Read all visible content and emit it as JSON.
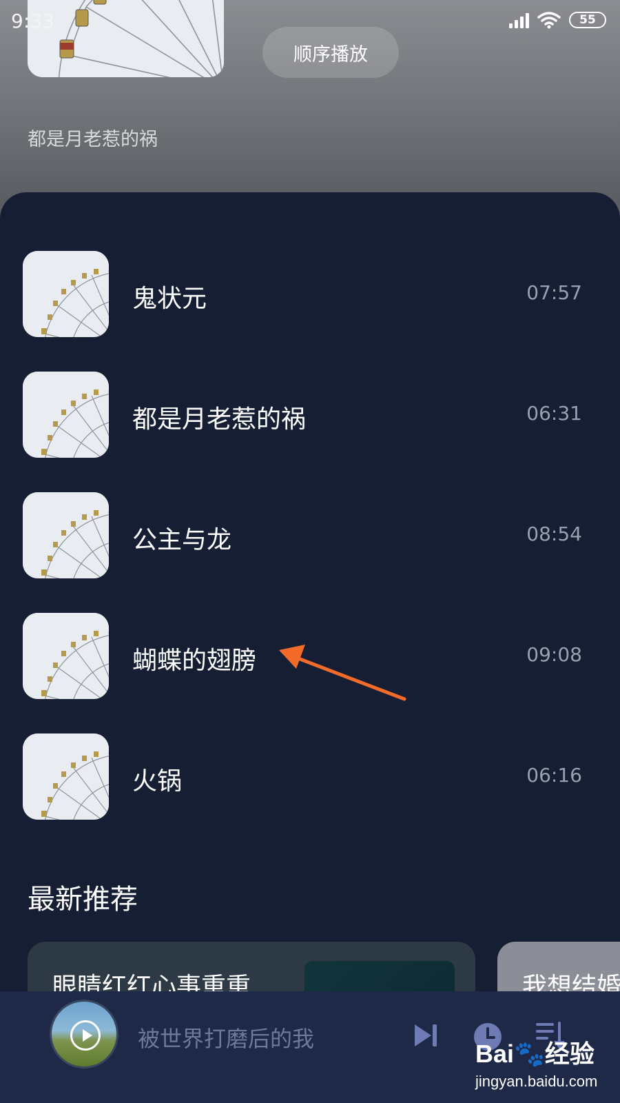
{
  "status_bar": {
    "time": "9:33",
    "battery": "55"
  },
  "header": {
    "play_mode_label": "顺序播放",
    "current_album": "都是月老惹的祸"
  },
  "playlist": [
    {
      "title": "鬼状元",
      "duration": "07:57"
    },
    {
      "title": "都是月老惹的祸",
      "duration": "06:31"
    },
    {
      "title": "公主与龙",
      "duration": "08:54"
    },
    {
      "title": "蝴蝶的翅膀",
      "duration": "09:08"
    },
    {
      "title": "火锅",
      "duration": "06:16"
    }
  ],
  "recommend": {
    "section_title": "最新推荐",
    "cards": [
      {
        "title": "眼睛红红心事重重"
      },
      {
        "title": "我想结婚"
      }
    ]
  },
  "mini_player": {
    "now_playing": "被世界打磨后的我"
  },
  "watermark": {
    "brand": "Bai🐾经验",
    "url": "jingyan.baidu.com"
  },
  "colors": {
    "panel_bg": "#161e33",
    "mini_player_bg": "#1e2847",
    "arrow": "#f26b2a",
    "duration_text": "#9aa0ad",
    "player_icon": "#6e7bb5"
  },
  "icons": {
    "album": "ferris-wheel-icon",
    "next": "skip-next-icon",
    "timer": "clock-icon",
    "queue": "playlist-icon"
  }
}
